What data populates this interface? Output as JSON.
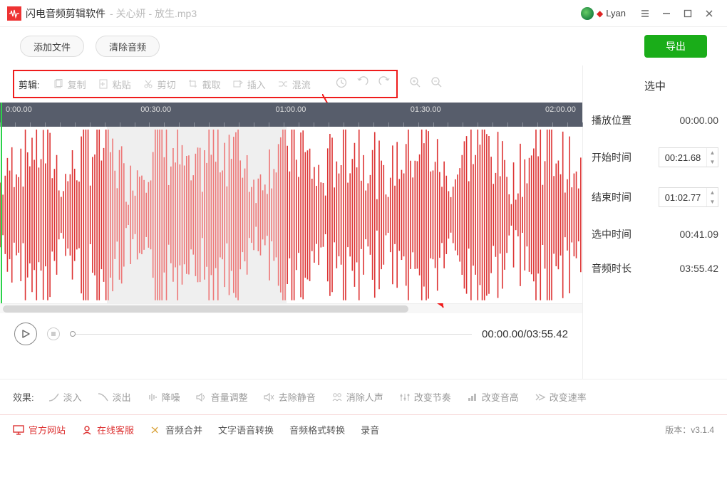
{
  "titlebar": {
    "app_name": "闪电音频剪辑软件",
    "file_separator": " - ",
    "file_name": "关心妍 - 放生.mp3",
    "username": "Lyan"
  },
  "toprow": {
    "add_file": "添加文件",
    "clear_audio": "清除音频",
    "export": "导出"
  },
  "toolbar": {
    "label": "剪辑:",
    "copy": "复制",
    "paste": "粘贴",
    "cut": "剪切",
    "crop": "截取",
    "insert": "插入",
    "mix": "混流"
  },
  "ruler_marks": [
    "0:00.00",
    "00:30.00",
    "01:00.00",
    "01:30.00",
    "02:00.00"
  ],
  "transport": {
    "time_display": "00:00.00/03:55.42"
  },
  "right_panel": {
    "title": "选中",
    "play_pos_label": "播放位置",
    "play_pos": "00:00.00",
    "start_label": "开始时间",
    "start": "00:21.68",
    "end_label": "结束时间",
    "end": "01:02.77",
    "sel_len_label": "选中时间",
    "sel_len": "00:41.09",
    "total_len_label": "音频时长",
    "total_len": "03:55.42"
  },
  "effects": {
    "label": "效果:",
    "fade_in": "淡入",
    "fade_out": "淡出",
    "denoise": "降噪",
    "volume": "音量调整",
    "trim_silence": "去除静音",
    "remove_vocals": "消除人声",
    "change_tempo": "改变节奏",
    "change_pitch": "改变音高",
    "change_speed": "改变速率"
  },
  "footer": {
    "official_site": "官方网站",
    "online_service": "在线客服",
    "audio_merge": "音频合并",
    "tts": "文字语音转换",
    "audio_convert": "音频格式转换",
    "record": "录音",
    "version_label": "版本：",
    "version": "v3.1.4"
  },
  "selection": {
    "start_pct": 18.4,
    "end_pct": 49.2
  }
}
